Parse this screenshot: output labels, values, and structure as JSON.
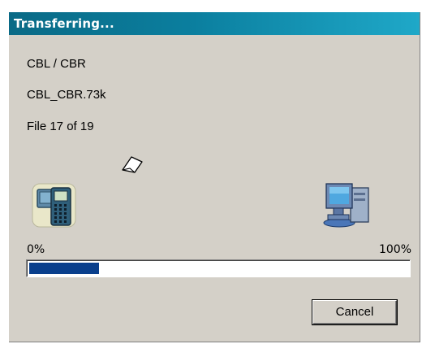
{
  "window": {
    "title": "Transferring..."
  },
  "transfer": {
    "device": "CBL / CBR",
    "file_name": "CBL_CBR.73k",
    "file_count": "File 17 of 19"
  },
  "icons": {
    "source": "calculator-icon",
    "destination": "computer-icon",
    "in_transit": "paper-icon"
  },
  "progress": {
    "min_label": "0%",
    "max_label": "100%",
    "fraction": 0.185,
    "fill_color": "#0a3f8c"
  },
  "buttons": {
    "cancel_label": "Cancel"
  },
  "colors": {
    "titlebar": "#0b7f9f",
    "dialog_bg": "#d4d0c8"
  }
}
